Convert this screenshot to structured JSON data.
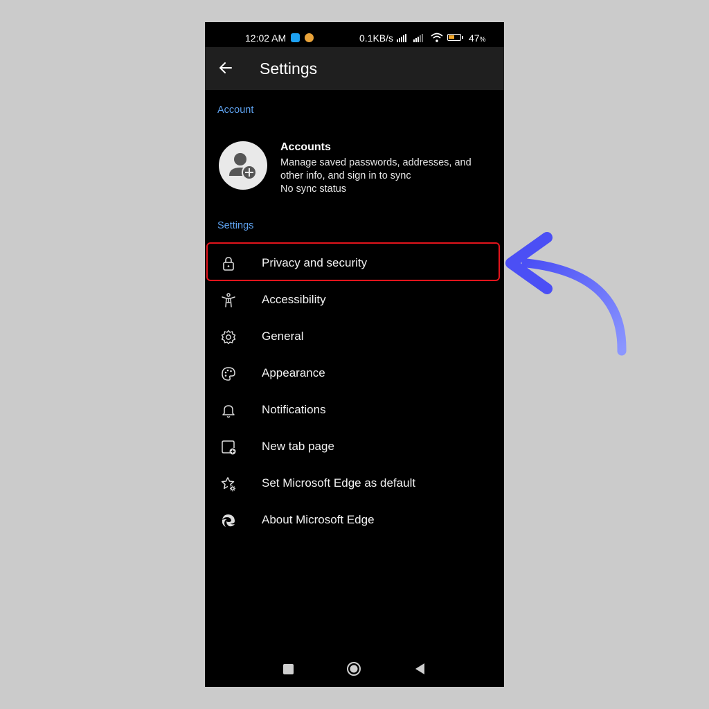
{
  "status_bar": {
    "time": "12:02 AM",
    "network_speed": "0.1KB/s",
    "battery_percent": "47",
    "battery_unit": "%",
    "battery_level": 0.47
  },
  "app_bar": {
    "title": "Settings",
    "back_icon": "arrow-left-icon"
  },
  "sections": {
    "account_label": "Account",
    "settings_label": "Settings"
  },
  "account": {
    "title": "Accounts",
    "description": "Manage saved passwords, addresses, and other info, and sign in to sync",
    "sync_status": "No sync status",
    "icon": "add-user-icon"
  },
  "settings_items": [
    {
      "label": "Privacy and security",
      "icon": "lock-icon"
    },
    {
      "label": "Accessibility",
      "icon": "accessibility-icon"
    },
    {
      "label": "General",
      "icon": "gear-icon"
    },
    {
      "label": "Appearance",
      "icon": "palette-icon"
    },
    {
      "label": "Notifications",
      "icon": "bell-icon"
    },
    {
      "label": "New tab page",
      "icon": "new-tab-icon"
    },
    {
      "label": "Set Microsoft Edge as default",
      "icon": "star-gear-icon"
    },
    {
      "label": "About Microsoft Edge",
      "icon": "edge-logo-icon"
    }
  ],
  "colors": {
    "accent": "#5ea2ef",
    "highlight_border": "#e3141c",
    "annotation_arrow": "#5a63f5",
    "background": "#cbcbcb"
  }
}
